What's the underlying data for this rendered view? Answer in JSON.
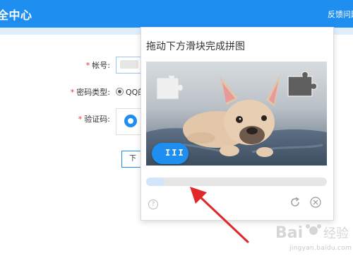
{
  "header": {
    "title": "全中心",
    "feedback": "反馈问题"
  },
  "form": {
    "account_label": "帐号:",
    "password_type_label": "密码类型:",
    "radio_option": "QQ的",
    "captcha_label": "验证码:",
    "button_text": "下"
  },
  "captcha_popup": {
    "title": "拖动下方滑块完成拼图",
    "slider_grip": "III",
    "slider_progress": 0.1,
    "help": "?"
  },
  "watermark": {
    "text": "jingyan.baidu.com",
    "brand": "Bai经验"
  },
  "colors": {
    "accent": "#1f8ef1",
    "required": "#e33333",
    "arrow": "#e02828"
  },
  "icons": [
    "help-icon",
    "refresh-icon",
    "close-icon",
    "puzzle-piece-icon"
  ]
}
